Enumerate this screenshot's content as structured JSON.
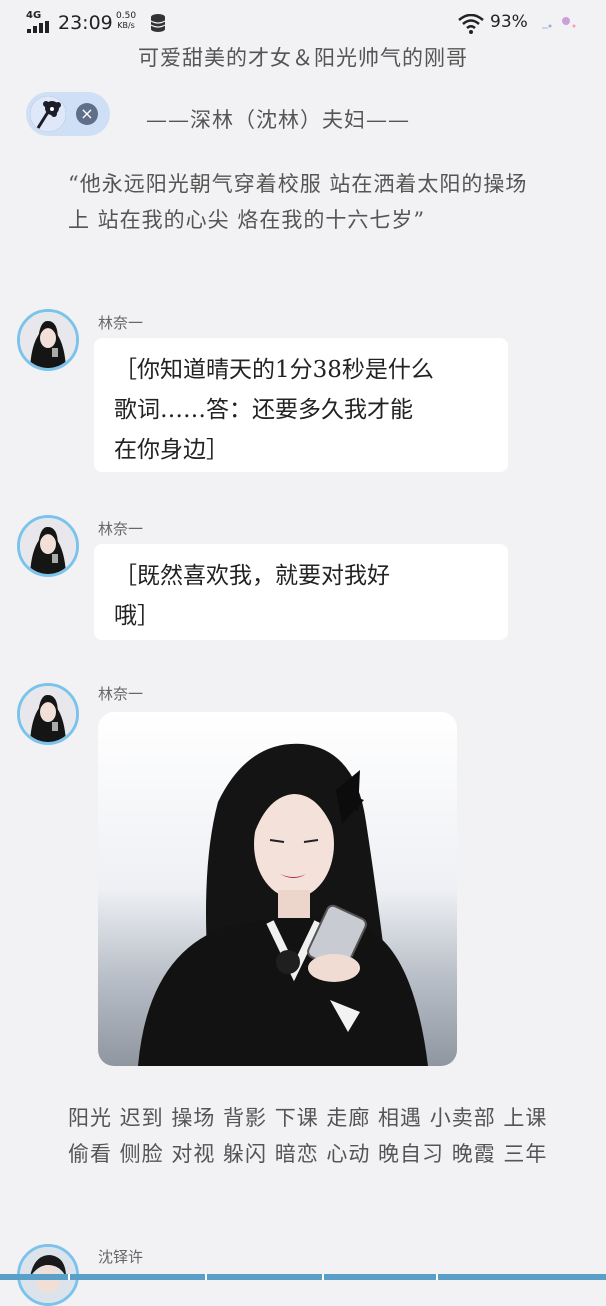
{
  "status_bar": {
    "network": "4G",
    "time": "23:09",
    "speed_value": "0.50",
    "speed_unit": "KB/s",
    "battery": "93%"
  },
  "header": {
    "couple_title": "可爱甜美的才女＆阳光帅气的刚哥",
    "close_label": "×",
    "couple_name": "——深林（沈林）夫妇——"
  },
  "quote": "“他永远阳光朝气穿着校服 站在洒着太阳的操场上 站在我的心尖 烙在我的十六七岁”",
  "messages": [
    {
      "sender": "林奈一",
      "lines": [
        "［你知道晴天的1分38秒是什么",
        "歌词……答：还要多久我才能",
        "在你身边］"
      ]
    },
    {
      "sender": "林奈一",
      "lines": [
        "［既然喜欢我，就要对我好",
        "哦］"
      ]
    },
    {
      "sender": "林奈一",
      "type": "image"
    }
  ],
  "tags": "阳光 迟到 操场 背影 下课 走廊 相遇 小卖部 上课 偷看 侧脸 对视 躲闪 暗恋 心动 晚自习 晚霞 三年",
  "next_message": {
    "sender": "沈铎许"
  },
  "colors": {
    "background": "#f2f2f4",
    "bubble": "#ffffff",
    "avatar_ring": "#7cc3ec",
    "chip": "#cfe0f6"
  },
  "icons": [
    "signal-icon",
    "database-icon",
    "wifi-icon",
    "close-icon"
  ]
}
